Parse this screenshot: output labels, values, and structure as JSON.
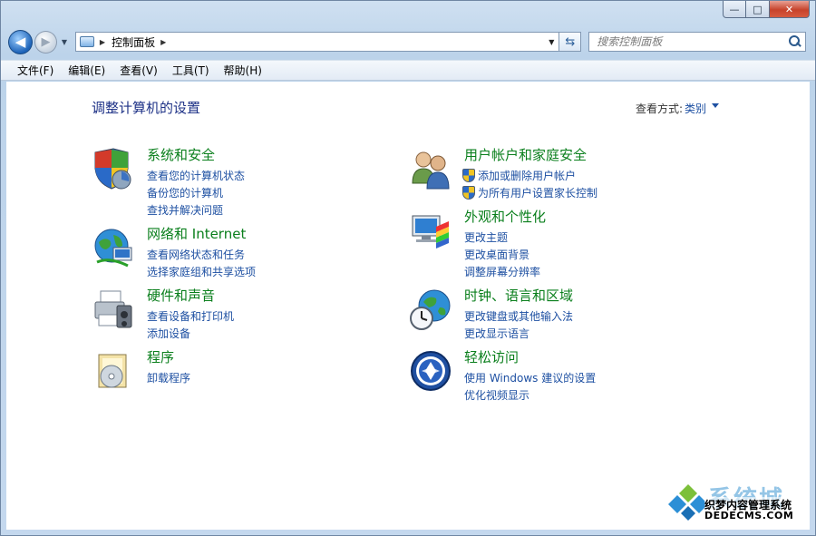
{
  "window": {
    "caption": {
      "minimize": "—",
      "maximize": "□",
      "close": "✕"
    }
  },
  "nav": {
    "back_glyph": "◀",
    "forward_glyph": "▶",
    "address_crumbs": [
      "控制面板"
    ],
    "search_placeholder": "搜索控制面板"
  },
  "menubar": {
    "items": [
      "文件(F)",
      "编辑(E)",
      "查看(V)",
      "工具(T)",
      "帮助(H)"
    ]
  },
  "main": {
    "title": "调整计算机的设置",
    "view_by_label": "查看方式:",
    "view_by_value": "类别",
    "categories": [
      {
        "title": "系统和安全",
        "icon": "shield-security-icon",
        "links": [
          "查看您的计算机状态",
          "备份您的计算机",
          "查找并解决问题"
        ]
      },
      {
        "title": "网络和 Internet",
        "icon": "network-globe-icon",
        "links": [
          "查看网络状态和任务",
          "选择家庭组和共享选项"
        ]
      },
      {
        "title": "硬件和声音",
        "icon": "printer-hardware-icon",
        "links": [
          "查看设备和打印机",
          "添加设备"
        ]
      },
      {
        "title": "程序",
        "icon": "programs-disc-icon",
        "links": [
          "卸载程序"
        ]
      },
      {
        "title": "用户帐户和家庭安全",
        "icon": "users-icon",
        "links": [
          "添加或删除用户帐户",
          "为所有用户设置家长控制"
        ]
      },
      {
        "title": "外观和个性化",
        "icon": "monitor-palette-icon",
        "links": [
          "更改主题",
          "更改桌面背景",
          "调整屏幕分辨率"
        ]
      },
      {
        "title": "时钟、语言和区域",
        "icon": "clock-globe-icon",
        "links": [
          "更改键盘或其他输入法",
          "更改显示语言"
        ]
      },
      {
        "title": "轻松访问",
        "icon": "ease-of-access-icon",
        "links": [
          "使用 Windows 建议的设置",
          "优化视频显示"
        ]
      }
    ]
  },
  "watermark": {
    "big": "系统城",
    "line1": "织梦内容管理系统",
    "line2": "DEDECMS.COM"
  },
  "colors": {
    "category_title": "#0a7f1c",
    "link": "#1e50a2",
    "page_title": "#1e3287"
  }
}
